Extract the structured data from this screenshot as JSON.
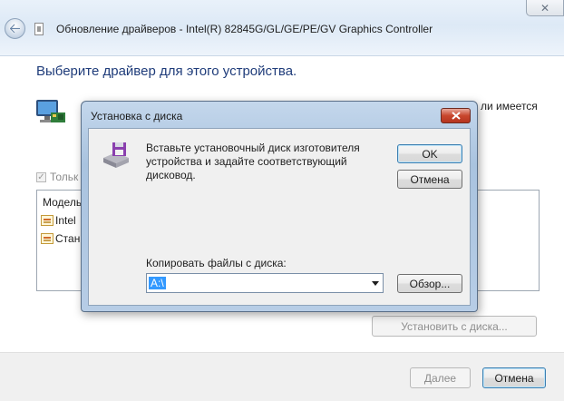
{
  "wizard": {
    "title": "Обновление драйверов - Intel(R) 82845G/GL/GE/PE/GV Graphics Controller",
    "heading": "Выберите драйвер для этого устройства.",
    "partial_description": "ли имеется",
    "checkbox_label": "Тольк",
    "list": {
      "header": "Модель",
      "items": [
        "Intel",
        "Стан"
      ]
    },
    "install_from_disk": "Установить с диска...",
    "next": "Далее",
    "cancel": "Отмена"
  },
  "dialog": {
    "title": "Установка с диска",
    "message": "Вставьте установочный диск изготовителя устройства и задайте соответствующий дисковод.",
    "ok": "OK",
    "cancel": "Отмена",
    "copy_label": "Копировать файлы с диска:",
    "path_value": "A:\\",
    "browse": "Обзор..."
  },
  "colors": {
    "heading": "#1f3c7a",
    "dialog_frame": "#b7cde6",
    "selection": "#3399ff"
  },
  "icons": [
    "back-arrow-icon",
    "document-icon",
    "close-icon",
    "monitor-icon",
    "certificate-icon",
    "floppy-disk-icon",
    "dropdown-arrow-icon"
  ]
}
